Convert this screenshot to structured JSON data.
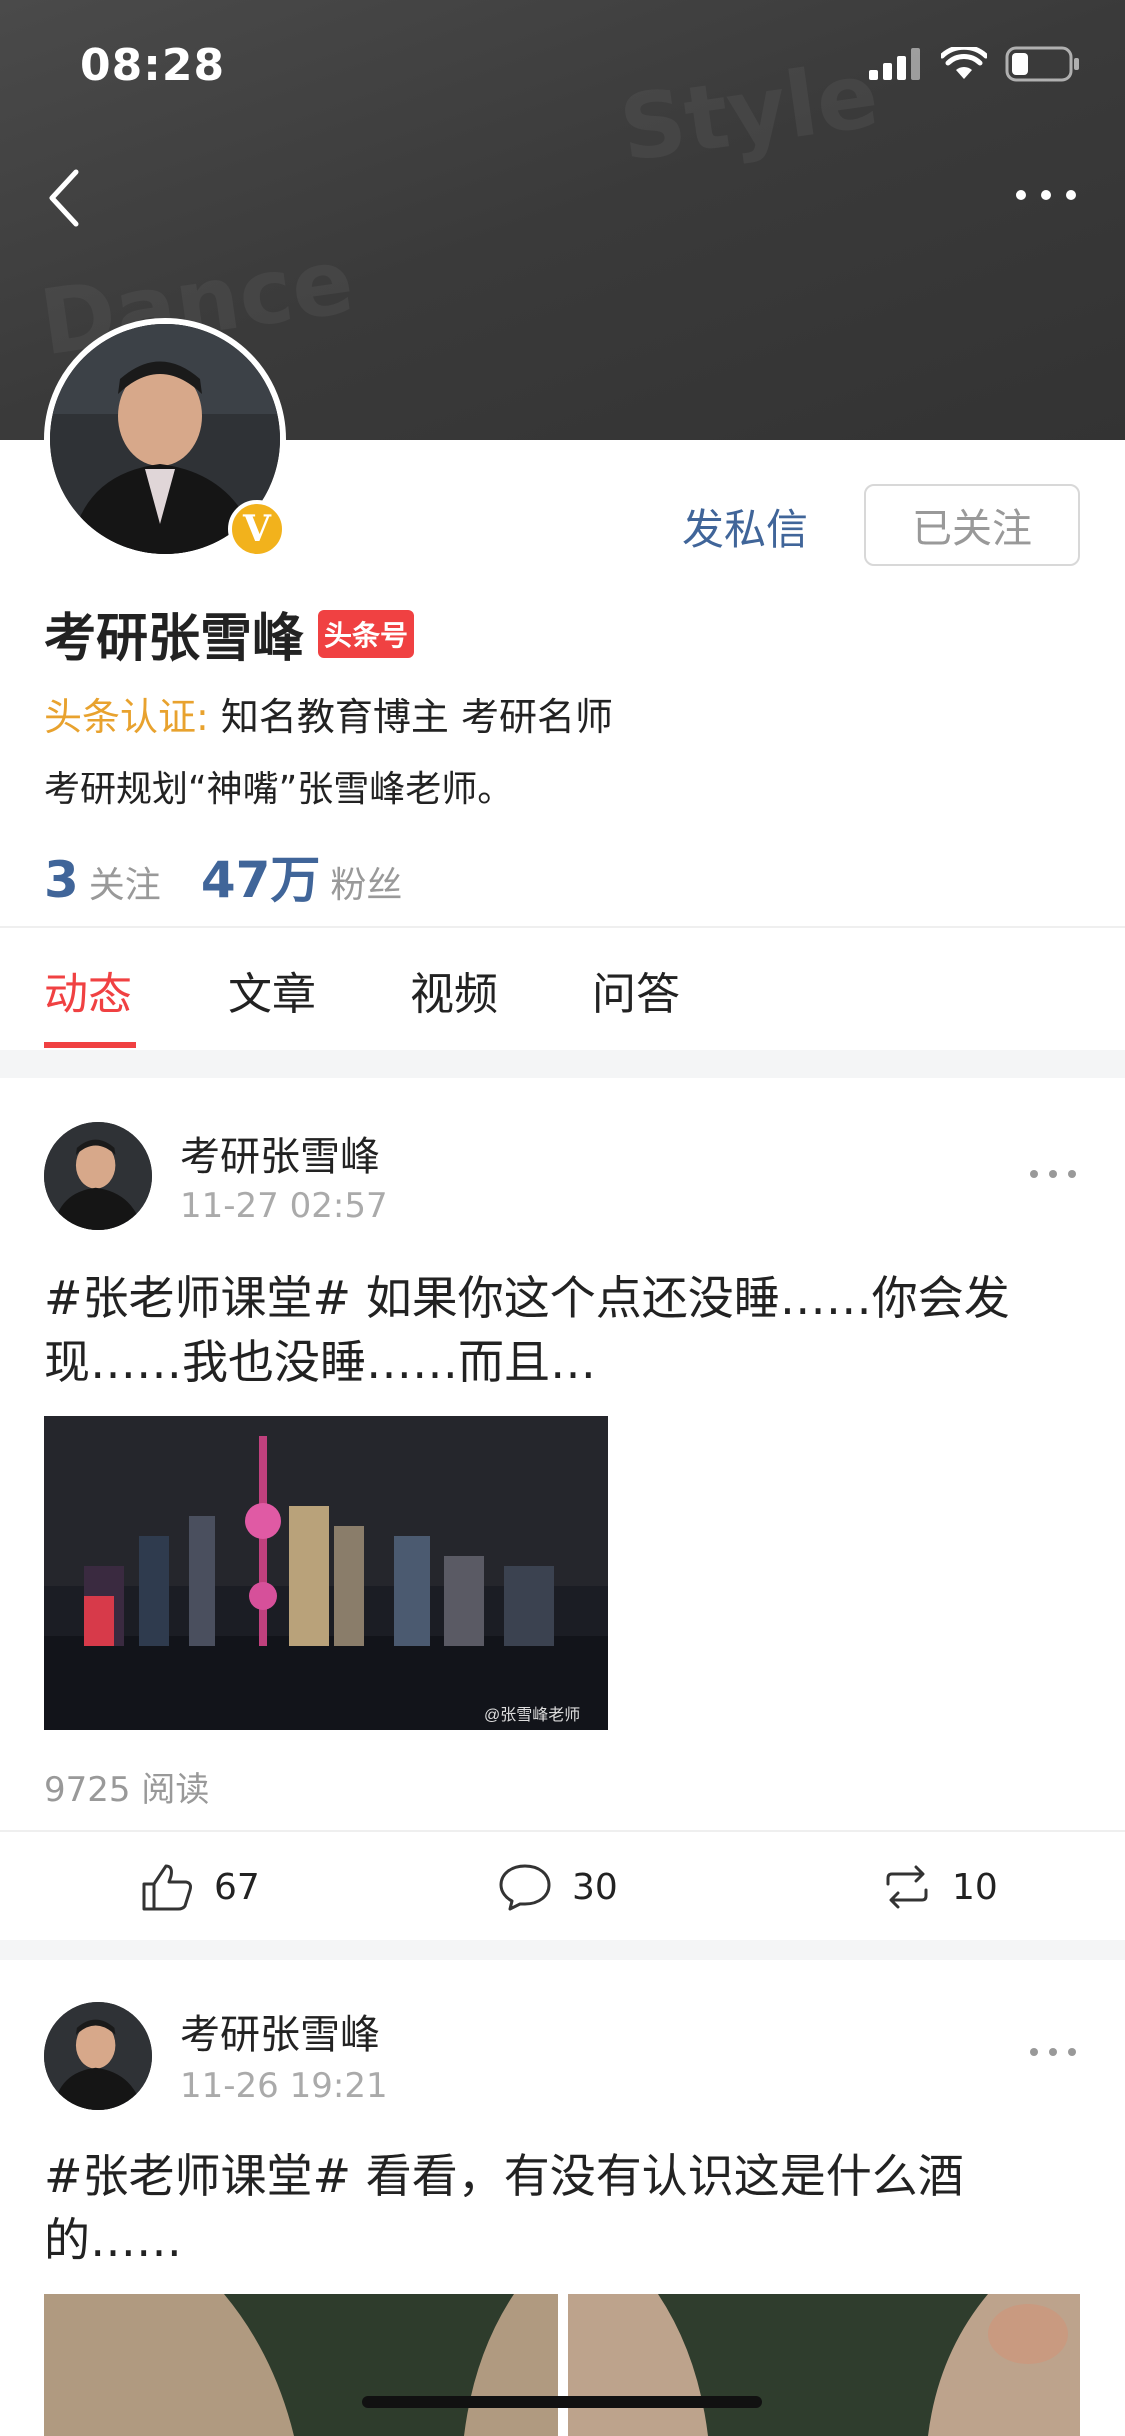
{
  "status_bar": {
    "time": "08:28"
  },
  "profile": {
    "name": "考研张雪峰",
    "tag": "头条号",
    "cert_label": "头条认证:",
    "cert_text": "知名教育博主 考研名师",
    "bio": "考研规划“神嘴”张雪峰老师。",
    "following_count": "3",
    "following_label": "关注",
    "followers_count": "47万",
    "followers_label": "粉丝",
    "message_button": "发私信",
    "follow_button": "已关注"
  },
  "tabs": [
    {
      "label": "动态",
      "active": true
    },
    {
      "label": "文章",
      "active": false
    },
    {
      "label": "视频",
      "active": false
    },
    {
      "label": "问答",
      "active": false
    }
  ],
  "posts": [
    {
      "author": "考研张雪峰",
      "time": "11-27 02:57",
      "text": "#张老师课堂# 如果你这个点还没睡……你会发现……我也没睡……而且…",
      "image_watermark": "@张雪峰老师",
      "reads": "9725 阅读",
      "likes": "67",
      "comments": "30",
      "reposts": "10"
    },
    {
      "author": "考研张雪峰",
      "time": "11-26 19:21",
      "text": "#张老师课堂# 看看，有没有认识这是什么酒的……"
    }
  ],
  "colors": {
    "accent_red": "#f04142",
    "link_blue": "#406599",
    "cert_orange": "#e8a22e"
  }
}
